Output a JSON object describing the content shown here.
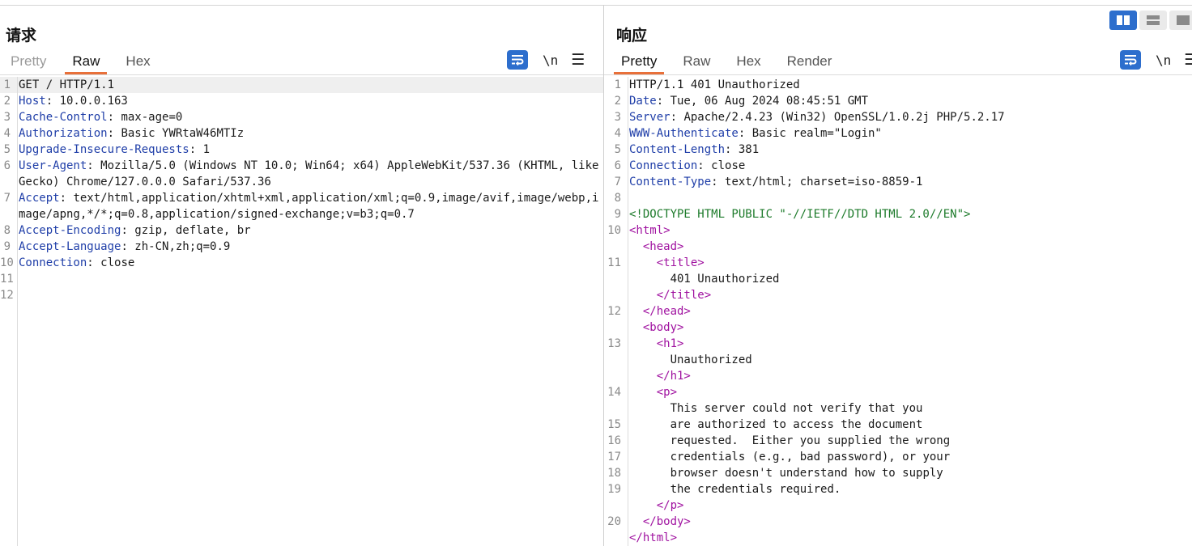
{
  "request": {
    "title": "请求",
    "tabs": [
      "Pretty",
      "Raw",
      "Hex"
    ],
    "active_tab": "Raw",
    "newline_label": "\\n",
    "lines": [
      {
        "n": "1",
        "text": "GET / HTTP/1.1"
      },
      {
        "n": "2",
        "name": "Host",
        "value": "10.0.0.163"
      },
      {
        "n": "3",
        "name": "Cache-Control",
        "value": "max-age=0"
      },
      {
        "n": "4",
        "name": "Authorization",
        "value": "Basic YWRtaW46MTIz"
      },
      {
        "n": "5",
        "name": "Upgrade-Insecure-Requests",
        "value": "1"
      },
      {
        "n": "6",
        "name": "User-Agent",
        "value": "Mozilla/5.0 (Windows NT 10.0; Win64; x64) AppleWebKit/537.36 (KHTML, like Gecko) Chrome/127.0.0.0 Safari/537.36"
      },
      {
        "n": "7",
        "name": "Accept",
        "value": "text/html,application/xhtml+xml,application/xml;q=0.9,image/avif,image/webp,image/apng,*/*;q=0.8,application/signed-exchange;v=b3;q=0.7"
      },
      {
        "n": "8",
        "name": "Accept-Encoding",
        "value": "gzip, deflate, br"
      },
      {
        "n": "9",
        "name": "Accept-Language",
        "value": "zh-CN,zh;q=0.9"
      },
      {
        "n": "10",
        "name": "Connection",
        "value": "close"
      },
      {
        "n": "11",
        "text": ""
      },
      {
        "n": "12",
        "text": ""
      }
    ]
  },
  "response": {
    "title": "响应",
    "tabs": [
      "Pretty",
      "Raw",
      "Hex",
      "Render"
    ],
    "active_tab": "Pretty",
    "newline_label": "\\n",
    "lines": [
      {
        "n": "1",
        "text": "HTTP/1.1 401 Unauthorized"
      },
      {
        "n": "2",
        "name": "Date",
        "value": "Tue, 06 Aug 2024 08:45:51 GMT"
      },
      {
        "n": "3",
        "name": "Server",
        "value": "Apache/2.4.23 (Win32) OpenSSL/1.0.2j PHP/5.2.17"
      },
      {
        "n": "4",
        "name": "WWW-Authenticate",
        "value": "Basic realm=\"Login\""
      },
      {
        "n": "5",
        "name": "Content-Length",
        "value": "381"
      },
      {
        "n": "6",
        "name": "Connection",
        "value": "close"
      },
      {
        "n": "7",
        "name": "Content-Type",
        "value": "text/html; charset=iso-8859-1"
      },
      {
        "n": "8",
        "text": ""
      },
      {
        "n": "9",
        "doctype": "<!DOCTYPE HTML PUBLIC \"-//IETF//DTD HTML 2.0//EN\">"
      },
      {
        "n": "10",
        "tag": "<html>"
      },
      {
        "n": "",
        "indent": "  ",
        "tag": "<head>"
      },
      {
        "n": "11",
        "indent": "    ",
        "tag": "<title>"
      },
      {
        "n": "",
        "indent": "      ",
        "text": "401 Unauthorized"
      },
      {
        "n": "",
        "indent": "    ",
        "tag": "</title>"
      },
      {
        "n": "12",
        "indent": "  ",
        "tag": "</head>"
      },
      {
        "n": "",
        "indent": "  ",
        "tag": "<body>"
      },
      {
        "n": "13",
        "indent": "    ",
        "tag": "<h1>"
      },
      {
        "n": "",
        "indent": "      ",
        "text": "Unauthorized"
      },
      {
        "n": "",
        "indent": "    ",
        "tag": "</h1>"
      },
      {
        "n": "14",
        "indent": "    ",
        "tag": "<p>"
      },
      {
        "n": "",
        "indent": "      ",
        "text": "This server could not verify that you"
      },
      {
        "n": "15",
        "indent": "      ",
        "text": "are authorized to access the document"
      },
      {
        "n": "16",
        "indent": "      ",
        "text": "requested.  Either you supplied the wrong"
      },
      {
        "n": "17",
        "indent": "      ",
        "text": "credentials (e.g., bad password), or your"
      },
      {
        "n": "18",
        "indent": "      ",
        "text": "browser doesn't understand how to supply"
      },
      {
        "n": "19",
        "indent": "      ",
        "text": "the credentials required."
      },
      {
        "n": "",
        "indent": "    ",
        "tag": "</p>"
      },
      {
        "n": "20",
        "indent": "  ",
        "tag": "</body>"
      },
      {
        "n": "",
        "tag": "</html>"
      }
    ]
  },
  "colors": {
    "accent_tab": "#e8703a",
    "button_blue": "#2d6ecd",
    "header_name": "#1f3ea8",
    "html_tag": "#a012a0",
    "doctype": "#1c7a2a"
  },
  "icons": {
    "wrap": "word-wrap-icon",
    "menu": "hamburger-menu-icon",
    "layout_side": "split-horizontal-icon",
    "layout_stack": "split-vertical-icon",
    "layout_tabs": "single-pane-icon"
  }
}
